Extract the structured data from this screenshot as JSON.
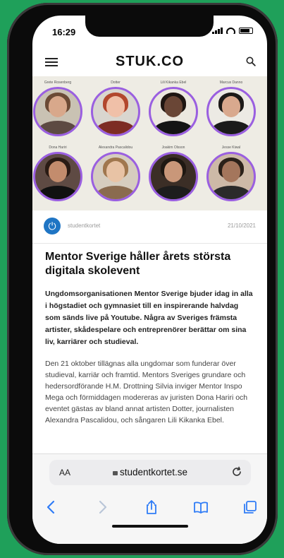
{
  "status_bar": {
    "time": "16:29"
  },
  "site": {
    "logo": "STUK.CO"
  },
  "hero": {
    "people": [
      {
        "name": "Grete Rosenberg",
        "skin": "#d8a88b",
        "hair": "#6b4a35",
        "body": "#5d4a42",
        "bg": "#c9c2b3"
      },
      {
        "name": "Dotter",
        "skin": "#f0c0a8",
        "hair": "#b2472d",
        "body": "#7d2c24",
        "bg": "#d9d6cf"
      },
      {
        "name": "Lili Kikanka Ebel",
        "skin": "#6a4636",
        "hair": "#1f1612",
        "body": "#141414",
        "bg": "#ece8df"
      },
      {
        "name": "Marcus Danno",
        "skin": "#d9a98e",
        "hair": "#1c1a18",
        "body": "#1b1b1b",
        "bg": "#eceae4"
      },
      {
        "name": "Dona Hariri",
        "skin": "#c38c6d",
        "hair": "#2a1b14",
        "body": "#111111",
        "bg": "#5e4a43"
      },
      {
        "name": "Alexandra Pascalidou",
        "skin": "#e8c3a5",
        "hair": "#a0774e",
        "body": "#8a6b4f",
        "bg": "#d6cdbf"
      },
      {
        "name": "Joakim Olsson",
        "skin": "#c99779",
        "hair": "#1f1812",
        "body": "#1d1d1d",
        "bg": "#3b2e26"
      },
      {
        "name": "Jesse Kiwal",
        "skin": "#a4765c",
        "hair": "#2b2119",
        "body": "#2a2a2a",
        "bg": "#cdb9a7"
      }
    ]
  },
  "meta": {
    "source": "studentkortet",
    "date": "21/10/2021"
  },
  "article": {
    "headline": "Mentor Sverige håller årets största digitala skolevent",
    "lead": "Ungdomsorganisationen Mentor Sverige bjuder idag in alla i högstadiet och gymnasiet till en inspirerande halvdag som sänds live på Youtube. Några av Sveriges främsta artister, skådespelare och entreprenörer berättar om sina liv, karriärer och studieval.",
    "body": "Den 21 oktober tillägnas alla ungdomar som funderar över studieval, karriär och framtid. Mentors Sveriges grundare och hedersordförande H.M. Drottning Silvia inviger Mentor Inspo Mega och förmiddagen modereras av juristen Dona Hariri och eventet gästas av bland annat artisten Dotter, journalisten Alexandra Pascalidou, och sångaren Lili Kikanka Ebel."
  },
  "browser": {
    "aa_label": "AA",
    "url": "studentkortet.se"
  },
  "colors": {
    "avatar_ring": "#9a5fe0",
    "ios_blue": "#2f7cf6",
    "brand_blue": "#1f75c4"
  }
}
